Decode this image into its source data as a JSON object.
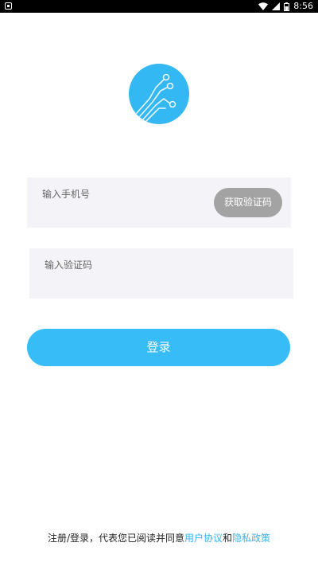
{
  "status_bar": {
    "time": "8:56",
    "icons": [
      "notification-icon",
      "wifi-icon",
      "signal-icon",
      "battery-icon"
    ]
  },
  "logo": {
    "icon": "circuit-logo-icon",
    "color": "#34b8f3"
  },
  "form": {
    "phone_placeholder": "输入手机号",
    "phone_value": "",
    "code_placeholder": "输入验证码",
    "code_value": "",
    "get_code_label": "获取验证码",
    "login_label": "登录"
  },
  "agreement": {
    "prefix": "注册/登录，代表您已阅读并同意",
    "user_agreement": "用户协议",
    "and": "和",
    "privacy_policy": "隐私政策"
  },
  "colors": {
    "accent": "#37bcf8",
    "link": "#37b3f3",
    "field_bg": "#f4f4f8",
    "disabled_button": "#a3a3a3"
  }
}
